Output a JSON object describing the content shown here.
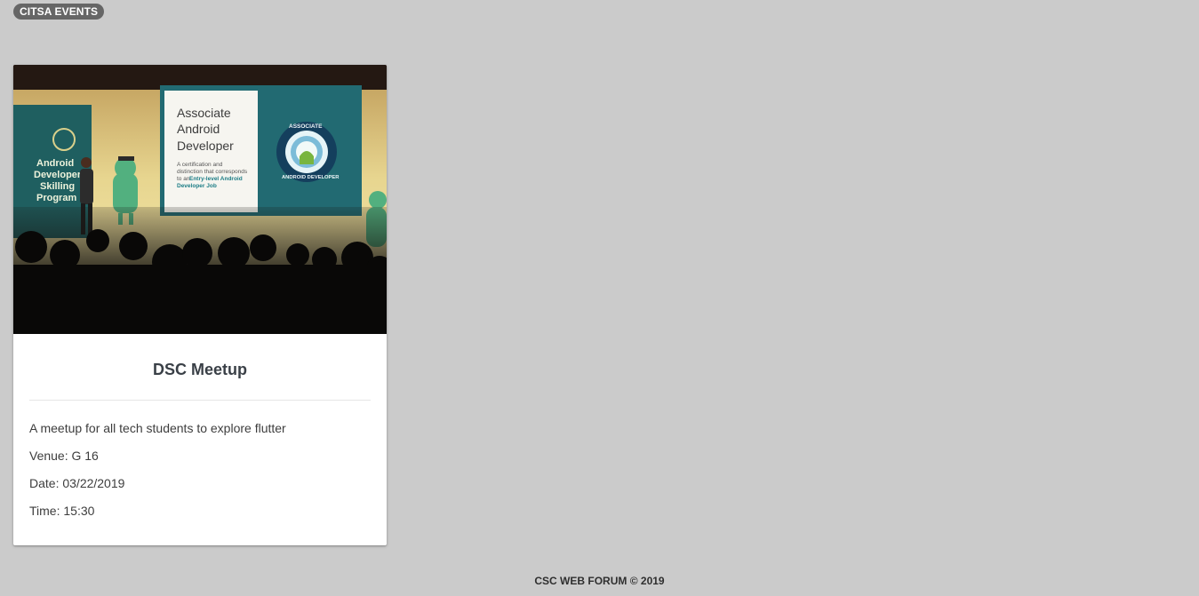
{
  "header": {
    "badge_label": "CITSA EVENTS"
  },
  "events": [
    {
      "title": "DSC Meetup",
      "description": "A meetup for all tech students to explore flutter",
      "venue": "Venue: G 16",
      "date": "Date: 03/22/2019",
      "time": "Time: 15:30",
      "image": {
        "slide_title_lines": [
          "Associate",
          "Android",
          "Developer"
        ],
        "slide_body_lines": [
          "A certification and",
          "distinction that corresponds",
          "to an"
        ],
        "slide_highlight_lines": [
          "Entry-level Android",
          "Developer Job"
        ],
        "backdrop_lines": [
          "Android",
          "Developer",
          "Skilling",
          "Program"
        ],
        "badge_top": "ASSOCIATE",
        "badge_bottom": "ANDROID DEVELOPER"
      }
    }
  ],
  "footer": {
    "text": "CSC WEB FORUM © 2019"
  },
  "colors": {
    "page_background": "#cbcbcb",
    "badge_background": "#666666",
    "card_background": "#ffffff",
    "title_text": "#3a4047",
    "body_text": "#3d3d3d"
  }
}
